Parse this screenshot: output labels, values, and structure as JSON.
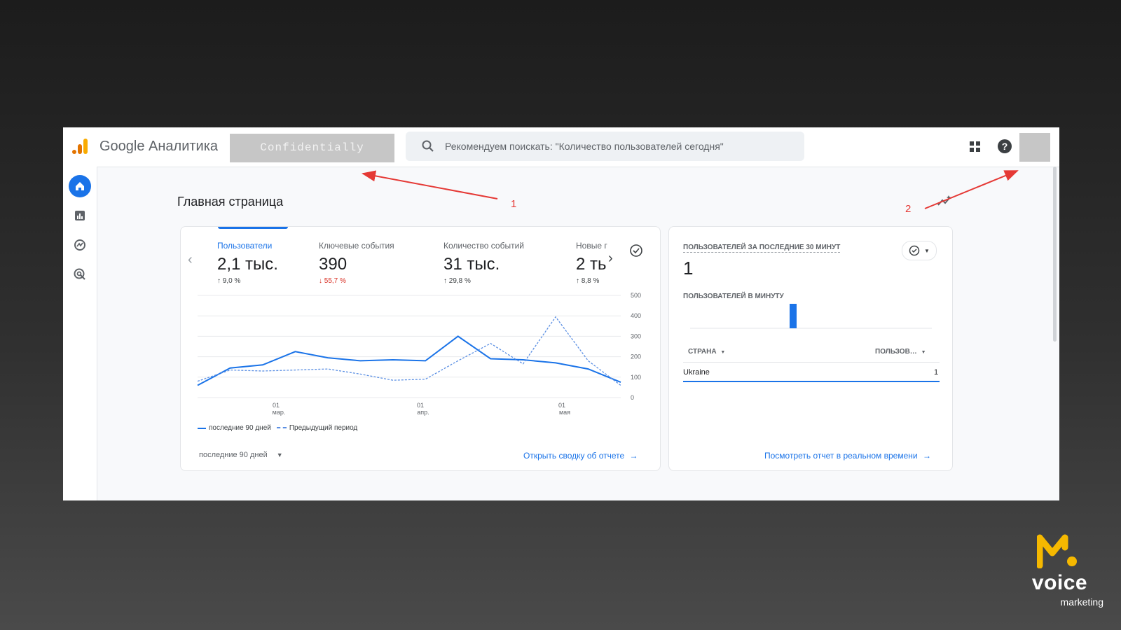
{
  "app": {
    "name": "Google Аналитика",
    "account": "Confidentially",
    "search_placeholder": "Рекомендуем поискать: \"Количество пользователей сегодня\""
  },
  "page": {
    "title": "Главная страница"
  },
  "metrics": [
    {
      "label": "Пользователи",
      "value": "2,1 тыс.",
      "change": "9,0 %",
      "direction": "up"
    },
    {
      "label": "Ключевые события",
      "value": "390",
      "change": "55,7 %",
      "direction": "down"
    },
    {
      "label": "Количество событий",
      "value": "31 тыс.",
      "change": "29,8 %",
      "direction": "up"
    },
    {
      "label": "Новые г",
      "value": "2 ть",
      "change": "8,8 %",
      "direction": "up"
    }
  ],
  "chart_data": {
    "type": "line",
    "x_tick_labels": [
      {
        "day": "01",
        "month": "мар."
      },
      {
        "day": "01",
        "month": "апр."
      },
      {
        "day": "01",
        "month": "мая"
      }
    ],
    "y_ticks": [
      0,
      100,
      200,
      300,
      400,
      500
    ],
    "ylim": [
      0,
      500
    ],
    "series": [
      {
        "name": "последние 90 дней",
        "style": "solid",
        "color": "#1a73e8",
        "values": [
          60,
          145,
          160,
          225,
          195,
          180,
          185,
          180,
          300,
          190,
          185,
          170,
          140,
          75
        ]
      },
      {
        "name": "Предыдущий период",
        "style": "dashed",
        "color": "#5b8fe3",
        "values": [
          80,
          135,
          130,
          135,
          140,
          115,
          85,
          90,
          180,
          265,
          165,
          395,
          180,
          60
        ]
      }
    ]
  },
  "card1": {
    "range_label": "последние 90 дней",
    "link": "Открыть сводку об отчете"
  },
  "realtime": {
    "title": "ПОЛЬЗОВАТЕЛЕЙ ЗА ПОСЛЕДНИЕ 30 МИНУТ",
    "value": "1",
    "subtitle": "ПОЛЬЗОВАТЕЛЕЙ В МИНУТУ",
    "col_country": "СТРАНА",
    "col_users": "ПОЛЬЗОВ…",
    "rows": [
      {
        "country": "Ukraine",
        "users": "1"
      }
    ],
    "link": "Посмотреть отчет в реальном времени"
  },
  "annotations": {
    "one": "1",
    "two": "2"
  },
  "brand": {
    "name": "voice",
    "sub": "marketing"
  },
  "colors": {
    "accent": "#1a73e8",
    "annotation": "#e53935",
    "down": "#d93025",
    "brand_yellow": "#f5b800"
  }
}
